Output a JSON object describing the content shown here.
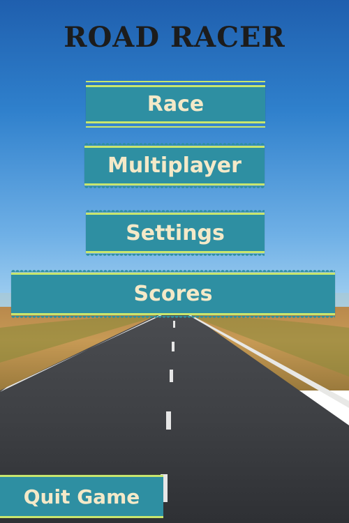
{
  "game": {
    "title": "ROAD RACER"
  },
  "menu": {
    "race_label": "Race",
    "multiplayer_label": "Multiplayer",
    "settings_label": "Settings",
    "scores_label": "Scores",
    "quit_label": "Quit Game"
  },
  "colors": {
    "button_fill": "#2e8fa2",
    "button_trim": "#c8e66e",
    "button_text": "#f4e9c8",
    "title_text": "#1c1c1c"
  }
}
